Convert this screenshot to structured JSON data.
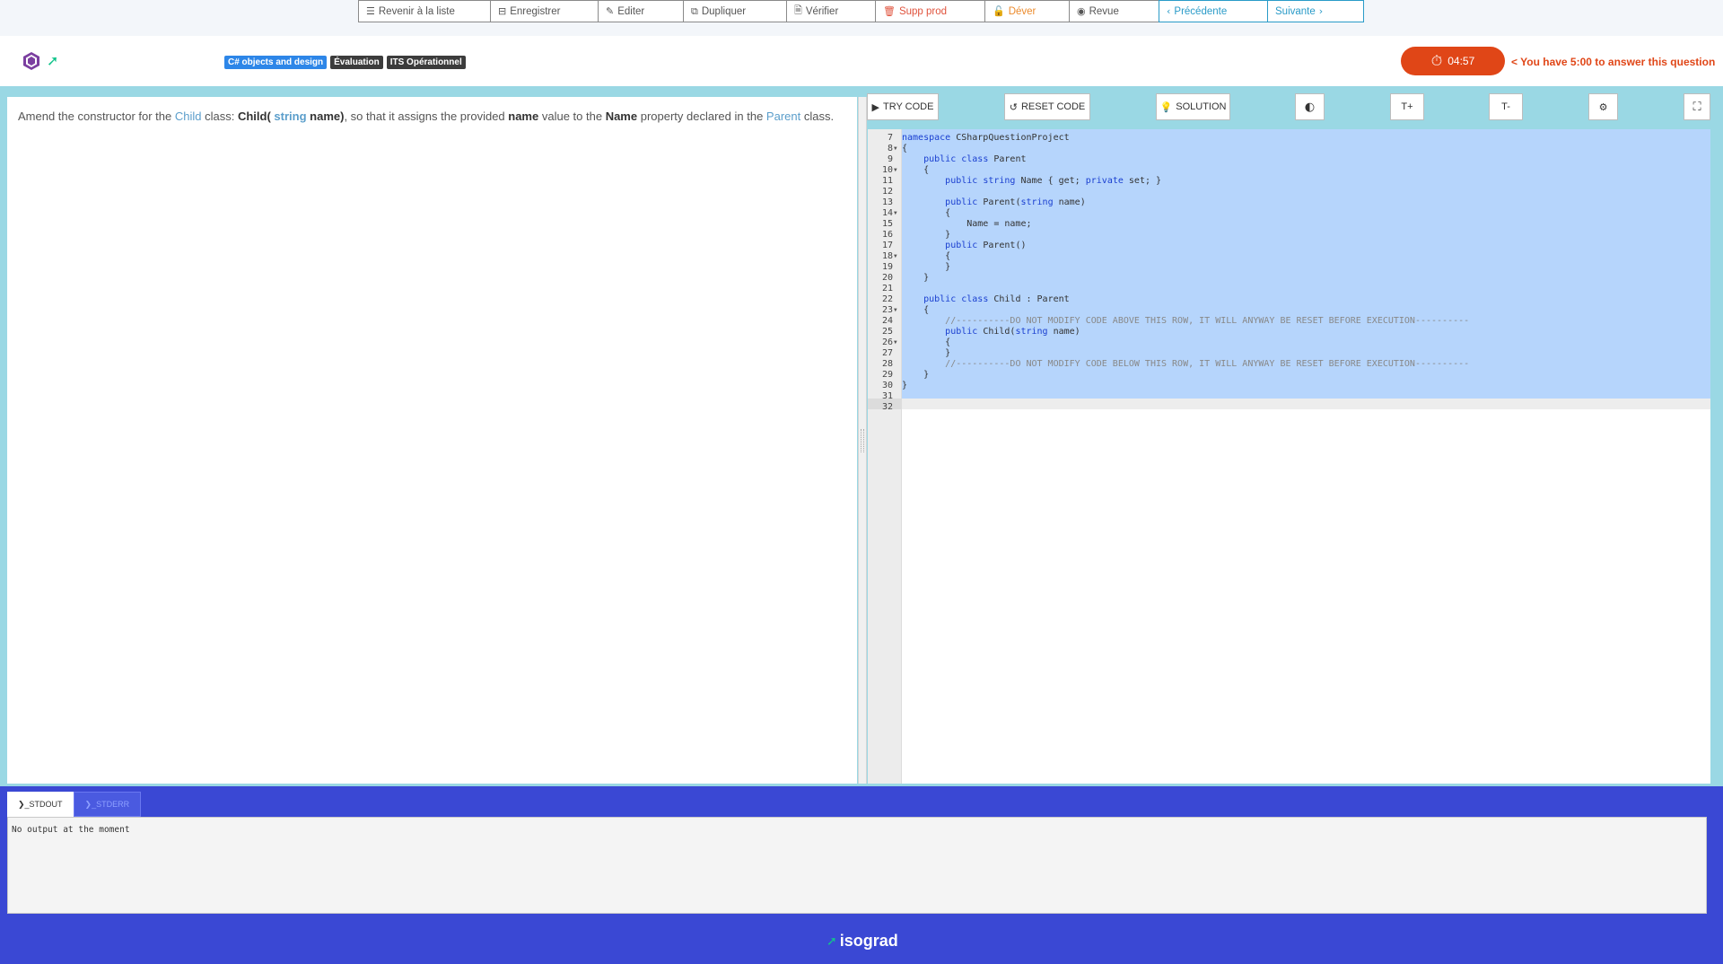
{
  "admin_toolbar": {
    "buttons": [
      {
        "label": "Revenir à la liste",
        "icon": "list-icon",
        "glyph": "☰"
      },
      {
        "label": "Enregistrer",
        "icon": "save-icon",
        "glyph": "⊟"
      },
      {
        "label": "Editer",
        "icon": "edit-icon",
        "glyph": "✎"
      },
      {
        "label": "Dupliquer",
        "icon": "copy-icon",
        "glyph": "⧉"
      },
      {
        "label": "Vérifier",
        "icon": "check-file-icon",
        "glyph": "🗎"
      },
      {
        "label": "Supp prod",
        "icon": "delete-icon",
        "glyph": "🗑"
      },
      {
        "label": "Déver",
        "icon": "unlock-icon",
        "glyph": "🔓"
      },
      {
        "label": "Revue",
        "icon": "eye-slash-icon",
        "glyph": "◉"
      },
      {
        "label": "Précédente",
        "icon": "chevron-left-icon",
        "glyph": "‹"
      },
      {
        "label": "Suivante",
        "icon": "chevron-right-icon",
        "glyph": "›"
      }
    ]
  },
  "header": {
    "tags": [
      "C# objects and design",
      "Évaluation",
      "ITS Opérationnel"
    ],
    "timer": "04:57",
    "time_note": "< You have 5:00 to answer this question"
  },
  "question": {
    "p1": "Amend the constructor for the ",
    "child_link": "Child",
    "p2": " class: ",
    "sig_a": "Child( ",
    "sig_type": "string",
    "sig_b": " name)",
    "p3": ", so that it assigns the provided ",
    "name_word": "name",
    "p4": " value to the ",
    "prop_word": "Name",
    "p5": " property declared in the ",
    "parent_link": "Parent",
    "p6": " class."
  },
  "editor_toolbar": {
    "try_code": "TRY CODE",
    "reset_code": "RESET CODE",
    "solution": "SOLUTION",
    "font_up": "T+",
    "font_down": "T-"
  },
  "code": {
    "line_numbers": [
      "7",
      "8",
      "9",
      "10",
      "11",
      "12",
      "13",
      "14",
      "15",
      "16",
      "17",
      "18",
      "19",
      "20",
      "21",
      "22",
      "23",
      "24",
      "25",
      "26",
      "27",
      "28",
      "29",
      "30",
      "31",
      "32"
    ],
    "lines": [
      [
        [
          "kw",
          "namespace"
        ],
        [
          "t",
          " CSharpQuestionProject"
        ]
      ],
      [
        [
          "t",
          "{"
        ]
      ],
      [
        [
          "t",
          "    "
        ],
        [
          "kw",
          "public class"
        ],
        [
          "t",
          " Parent"
        ]
      ],
      [
        [
          "t",
          "    {"
        ]
      ],
      [
        [
          "t",
          "        "
        ],
        [
          "kw",
          "public string"
        ],
        [
          "t",
          " Name { get; "
        ],
        [
          "kw",
          "private"
        ],
        [
          "t",
          " set; }"
        ]
      ],
      [
        [
          "t",
          ""
        ]
      ],
      [
        [
          "t",
          "        "
        ],
        [
          "kw",
          "public"
        ],
        [
          "t",
          " Parent("
        ],
        [
          "kw",
          "string"
        ],
        [
          "t",
          " name)"
        ]
      ],
      [
        [
          "t",
          "        {"
        ]
      ],
      [
        [
          "t",
          "            Name = name;"
        ]
      ],
      [
        [
          "t",
          "        }"
        ]
      ],
      [
        [
          "t",
          "        "
        ],
        [
          "kw",
          "public"
        ],
        [
          "t",
          " Parent()"
        ]
      ],
      [
        [
          "t",
          "        {"
        ]
      ],
      [
        [
          "t",
          "        }"
        ]
      ],
      [
        [
          "t",
          "    }"
        ]
      ],
      [
        [
          "t",
          ""
        ]
      ],
      [
        [
          "t",
          "    "
        ],
        [
          "kw",
          "public class"
        ],
        [
          "t",
          " Child : Parent"
        ]
      ],
      [
        [
          "t",
          "    {"
        ]
      ],
      [
        [
          "t",
          "        "
        ],
        [
          "cm",
          "//----------DO NOT MODIFY CODE ABOVE THIS ROW, IT WILL ANYWAY BE RESET BEFORE EXECUTION----------"
        ]
      ],
      [
        [
          "t",
          "        "
        ],
        [
          "kw",
          "public"
        ],
        [
          "t",
          " Child("
        ],
        [
          "kw",
          "string"
        ],
        [
          "t",
          " name)"
        ]
      ],
      [
        [
          "t",
          "        {"
        ]
      ],
      [
        [
          "t",
          "        }"
        ]
      ],
      [
        [
          "t",
          "        "
        ],
        [
          "cm",
          "//----------DO NOT MODIFY CODE BELOW THIS ROW, IT WILL ANYWAY BE RESET BEFORE EXECUTION----------"
        ]
      ],
      [
        [
          "t",
          "    }"
        ]
      ],
      [
        [
          "t",
          "}"
        ]
      ],
      [
        [
          "t",
          ""
        ]
      ],
      [
        [
          "t",
          ""
        ]
      ]
    ],
    "fold_lines": [
      "8",
      "10",
      "14",
      "18",
      "23",
      "26"
    ]
  },
  "console": {
    "tab_stdout": "❯_STDOUT",
    "tab_stderr": "❯_STDERR",
    "output": "No output at the moment"
  },
  "footer": {
    "brand": "isograd"
  },
  "colors": {
    "timer": "#e04617",
    "keyword": "#1a3fd0",
    "selection": "#b6d5fc",
    "footer_bg": "#3a48d4"
  }
}
